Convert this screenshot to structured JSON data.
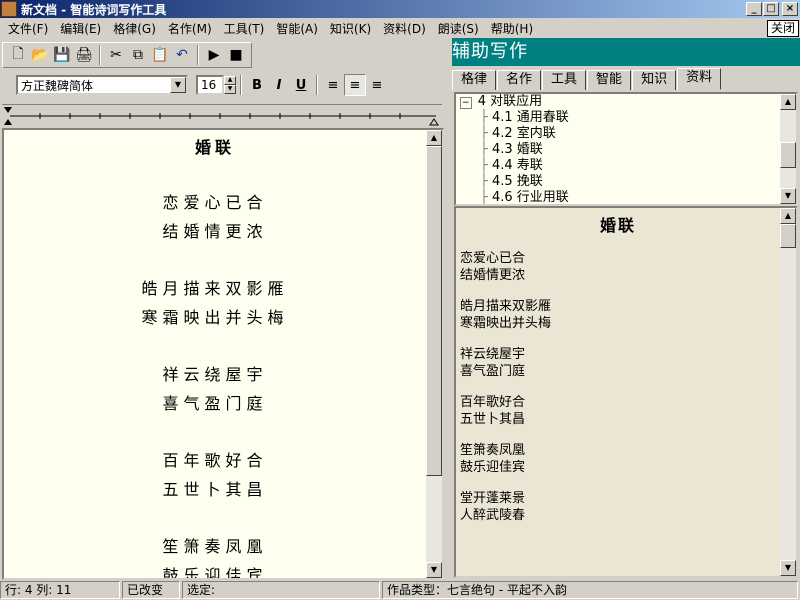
{
  "window": {
    "title": "新文档 - 智能诗词写作工具",
    "controls": [
      "_",
      "□",
      "×"
    ]
  },
  "menu": {
    "items": [
      "文件(F)",
      "编辑(E)",
      "格律(G)",
      "名作(M)",
      "工具(T)",
      "智能(A)",
      "知识(K)",
      "资料(D)",
      "朗读(S)",
      "帮助(H)"
    ],
    "close_label": "关闭"
  },
  "toolbar": {
    "icons": [
      "new-file-icon",
      "open-folder-icon",
      "save-icon",
      "print-icon",
      "cut-icon",
      "copy-icon",
      "paste-icon",
      "undo-icon",
      "play-icon",
      "stop-icon"
    ],
    "glyphs": [
      "🗋",
      "📂",
      "💾",
      "🖨",
      "✂",
      "⧉",
      "📋",
      "↶",
      "▶",
      "■"
    ]
  },
  "format": {
    "font": "方正魏碑简体",
    "size": "16",
    "bold": "B",
    "italic": "I",
    "underline": "U",
    "align_left": "≡",
    "align_center": "≡",
    "align_right": "≡"
  },
  "editor": {
    "title": "婚联",
    "stanzas": [
      [
        "恋爱心已合",
        "结婚情更浓"
      ],
      [
        "皓月描来双影雁",
        "寒霜映出并头梅"
      ],
      [
        "祥云绕屋宇",
        "喜气盈门庭"
      ],
      [
        "百年歌好合",
        "五世卜其昌"
      ],
      [
        "笙箫奏凤凰",
        "鼓乐迎佳宾"
      ]
    ]
  },
  "assist": {
    "header": "辅助写作",
    "tabs": [
      "格律",
      "名作",
      "工具",
      "智能",
      "知识",
      "资料"
    ],
    "active_tab": "资料",
    "tree": {
      "root": "4 对联应用",
      "children": [
        "4.1 通用春联",
        "4.2 室内联",
        "4.3 婚联",
        "4.4 寿联",
        "4.5 挽联",
        "4.6 行业用联"
      ]
    },
    "content": {
      "title": "婚联",
      "stanzas": [
        [
          "恋爱心已合",
          "结婚情更浓"
        ],
        [
          "皓月描来双影雁",
          "寒霜映出并头梅"
        ],
        [
          "祥云绕屋宇",
          "喜气盈门庭"
        ],
        [
          "百年歌好合",
          "五世卜其昌"
        ],
        [
          "笙箫奏凤凰",
          "鼓乐迎佳宾"
        ],
        [
          "堂开蓬莱景",
          "人醉武陵春"
        ]
      ]
    }
  },
  "status": {
    "position": "行: 4  列: 11",
    "modified": "已改变",
    "selection": "选定:",
    "type": "作品类型：七言绝句 - 平起不入韵"
  },
  "colors": {
    "title_bar": "#0a246a",
    "assist_header": "#008080",
    "editor_bg": "#fffff0",
    "content_bg": "#ebe6d4"
  }
}
